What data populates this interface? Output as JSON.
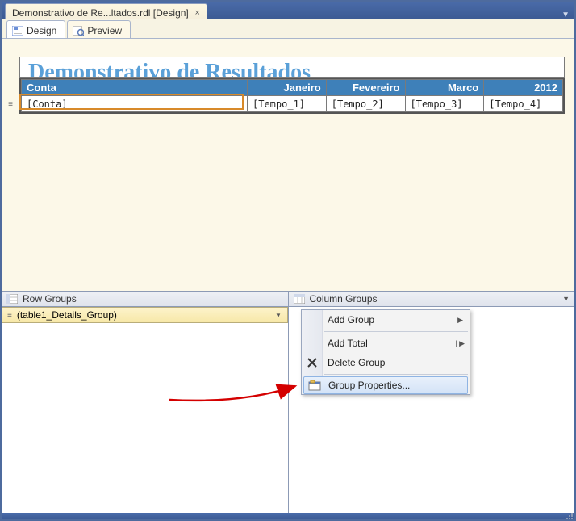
{
  "doc_tab": {
    "label": "Demonstrativo de Re...ltados.rdl [Design]"
  },
  "view_tabs": {
    "design": "Design",
    "preview": "Preview"
  },
  "report": {
    "title_hint": "Demonstrativo de Resultados",
    "headers": {
      "conta": "Conta",
      "jan": "Janeiro",
      "fev": "Fevereiro",
      "mar": "Marco",
      "year": "2012"
    },
    "row": {
      "conta": "[Conta]",
      "jan": "[Tempo_1]",
      "fev": "[Tempo_2]",
      "mar": "[Tempo_3]",
      "year": "[Tempo_4]"
    }
  },
  "groups": {
    "row_label": "Row Groups",
    "col_label": "Column Groups",
    "row_item": "(table1_Details_Group)"
  },
  "menu": {
    "add_group": "Add Group",
    "add_total": "Add Total",
    "delete_group": "Delete Group",
    "group_props": "Group Properties..."
  }
}
